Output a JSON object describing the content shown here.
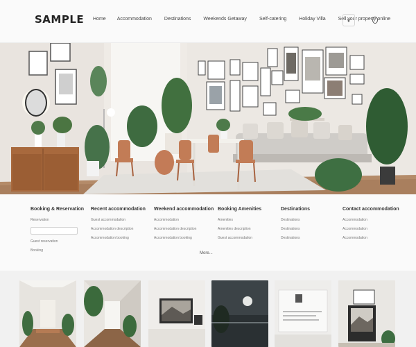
{
  "header": {
    "logo": "SAMPLE",
    "nav": [
      "Home",
      "Accommodation",
      "Destinations",
      "Weekends Getaway",
      "Self-catering",
      "Holiday Villa",
      "Sell your property online"
    ],
    "chevron_label": "v"
  },
  "info": {
    "columns": [
      {
        "title": "Booking & Reservation",
        "lines": [
          "Reservation",
          "Guest reservation",
          "Booking"
        ],
        "has_field": true
      },
      {
        "title": "Recent accommodation",
        "lines": [
          "Guest accommodation",
          "Accommodation description",
          "Accommodation booking"
        ],
        "has_field": false
      },
      {
        "title": "Weekend accommodation",
        "lines": [
          "Accommodation",
          "Accommodation description",
          "Accommodation booking"
        ],
        "has_field": false
      },
      {
        "title": "Booking Amenities",
        "lines": [
          "Amenities",
          "Amenities description",
          "Guest accommodation"
        ],
        "has_field": false
      },
      {
        "title": "Destinations",
        "lines": [
          "Destinations",
          "Destinations",
          "Destinations"
        ],
        "has_field": false
      },
      {
        "title": "Contact accommodation",
        "lines": [
          "Accommodation",
          "Accommodation",
          "Accommodation"
        ],
        "has_field": false
      }
    ],
    "more_link": "More..."
  },
  "colors": {
    "wall": "#e8e3dd",
    "floor": "#b08866",
    "sofa": "#c9c6c2",
    "chair": "#c07a55",
    "plant": "#3f6e44"
  }
}
